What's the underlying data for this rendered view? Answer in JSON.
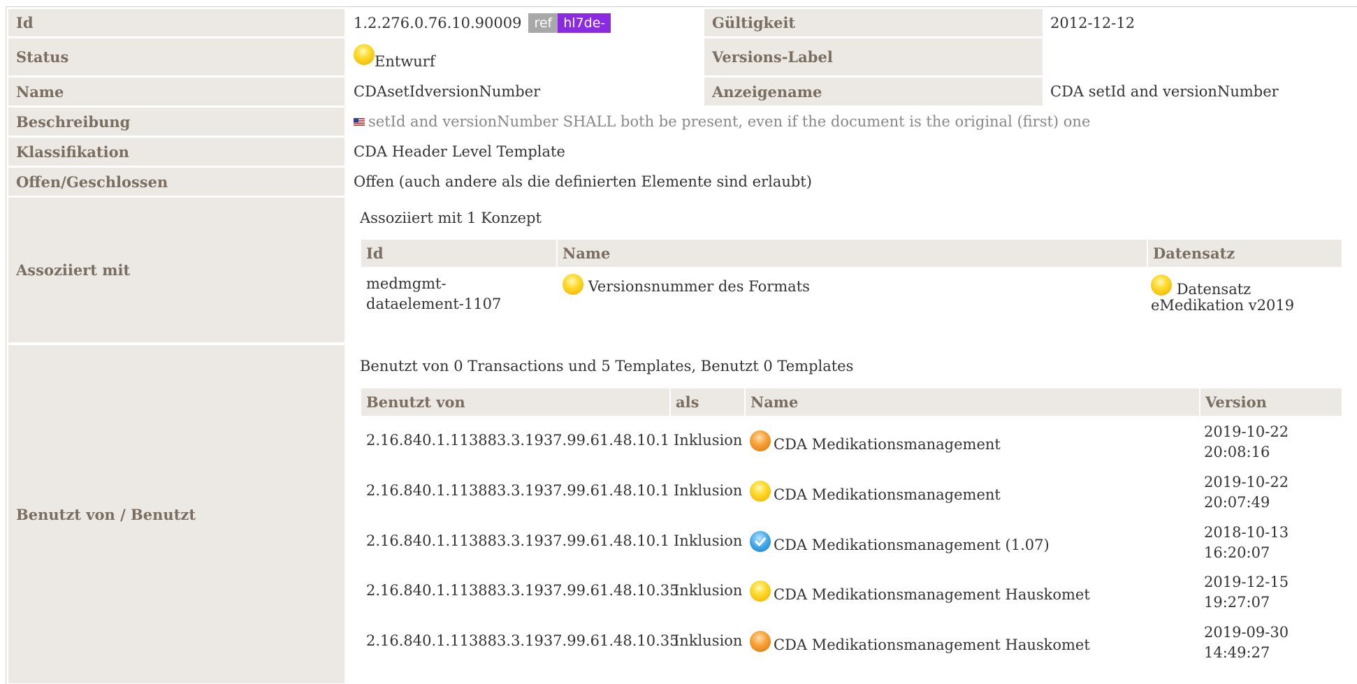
{
  "fields": {
    "id": {
      "label": "Id",
      "value": "1.2.276.0.76.10.90009",
      "ref_badge": "ref",
      "prefix_badge": "hl7de-"
    },
    "validity": {
      "label": "Gültigkeit",
      "value": "2012-12-12"
    },
    "status": {
      "label": "Status",
      "value": "Entwurf",
      "icon": "status-draft-yellow-icon"
    },
    "version_label": {
      "label": "Versions-Label",
      "value": ""
    },
    "name": {
      "label": "Name",
      "value": "CDAsetIdversionNumber"
    },
    "display_name": {
      "label": "Anzeigename",
      "value": "CDA setId and versionNumber"
    },
    "description": {
      "label": "Beschreibung",
      "value": "setId and versionNumber SHALL both be present, even if the document is the original (first) one",
      "flag": "us-flag-icon"
    },
    "classification": {
      "label": "Klassifikation",
      "value": "CDA Header Level Template"
    },
    "open_closed": {
      "label": "Offen/Geschlossen",
      "value": "Offen (auch andere als die definierten Elemente sind erlaubt)"
    }
  },
  "associated": {
    "label": "Assoziiert mit",
    "summary": "Assoziiert mit 1 Konzept",
    "headers": {
      "id": "Id",
      "name": "Name",
      "dataset": "Datensatz"
    },
    "rows": [
      {
        "id_line1": "medmgmt-",
        "id_line2": "dataelement-1107",
        "name": "Versionsnummer des Formats",
        "dataset_line1": "Datensatz",
        "dataset_line2": "eMedikation v2019"
      }
    ]
  },
  "used_by": {
    "label": "Benutzt von / Benutzt",
    "summary": "Benutzt von 0 Transactions und 5 Templates, Benutzt 0 Templates",
    "headers": {
      "used_by": "Benutzt von",
      "as": "als",
      "name": "Name",
      "version": "Version"
    },
    "rows": [
      {
        "oid": "2.16.840.1.113883.3.1937.99.61.48.10.1",
        "as": "Inklusion",
        "status": "orange",
        "name": "CDA Medikationsmanagement",
        "date": "2019-10-22",
        "time": "20:08:16"
      },
      {
        "oid": "2.16.840.1.113883.3.1937.99.61.48.10.1",
        "as": "Inklusion",
        "status": "yellow",
        "name": "CDA Medikationsmanagement",
        "date": "2019-10-22",
        "time": "20:07:49"
      },
      {
        "oid": "2.16.840.1.113883.3.1937.99.61.48.10.1",
        "as": "Inklusion",
        "status": "blue",
        "name": "CDA Medikationsmanagement (1.07)",
        "date": "2018-10-13",
        "time": "16:20:07"
      },
      {
        "oid": "2.16.840.1.113883.3.1937.99.61.48.10.35",
        "as": "Inklusion",
        "status": "yellow",
        "name": "CDA Medikationsmanagement Hauskomet",
        "date": "2019-12-15",
        "time": "19:27:07"
      },
      {
        "oid": "2.16.840.1.113883.3.1937.99.61.48.10.35",
        "as": "Inklusion",
        "status": "orange",
        "name": "CDA Medikationsmanagement Hauskomet",
        "date": "2019-09-30",
        "time": "14:49:27"
      }
    ]
  },
  "colors": {
    "label_bg": "#ece9e4",
    "label_text": "#7a6e62",
    "badge_ref": "#a8a8a8",
    "badge_prefix": "#8a2be2"
  }
}
